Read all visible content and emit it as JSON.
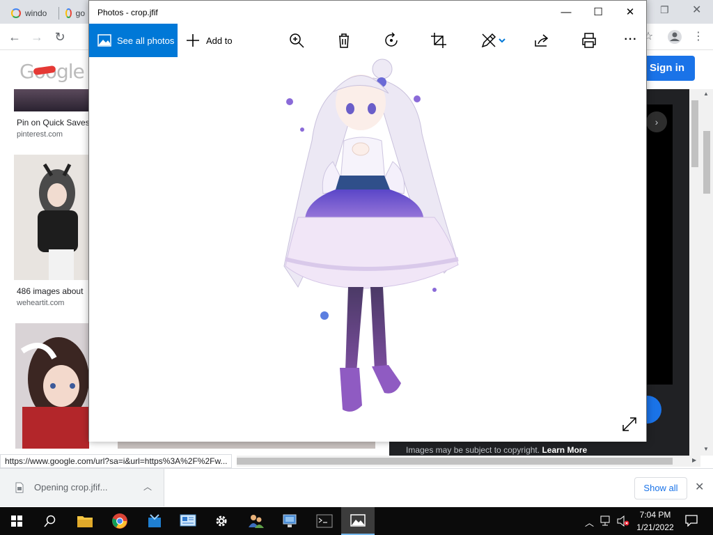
{
  "browser": {
    "tabs": [
      {
        "label": "windo"
      },
      {
        "label": "go"
      }
    ],
    "signin_label": "Sign in",
    "logo_text": "Google",
    "status_url": "https://www.google.com/url?sa=i&url=https%3A%2F%2Fw...",
    "results": [
      {
        "title": "Pin on Quick Saves",
        "site": "pinterest.com"
      },
      {
        "title": "486 images about",
        "site": "weheartit.com"
      }
    ],
    "panel_caption": "Images may be subject to copyright.",
    "panel_caption_link": "Learn More",
    "download": {
      "label": "Opening crop.jfif...",
      "show_all": "Show all"
    }
  },
  "photos": {
    "title": "Photos - crop.jfif",
    "see_all_label": "See all photos",
    "add_to_label": "Add to",
    "toolbar_icons": [
      "zoom-icon",
      "delete-icon",
      "rotate-icon",
      "crop-icon",
      "edit-icon",
      "share-icon",
      "print-icon",
      "more-icon"
    ]
  },
  "taskbar": {
    "time": "7:04 PM",
    "date": "1/21/2022",
    "icons": [
      "start-icon",
      "search-icon",
      "file-explorer-icon",
      "chrome-icon",
      "app-icon",
      "control-panel-icon",
      "settings-icon",
      "users-icon",
      "network-icon",
      "terminal-icon",
      "photos-icon"
    ]
  }
}
